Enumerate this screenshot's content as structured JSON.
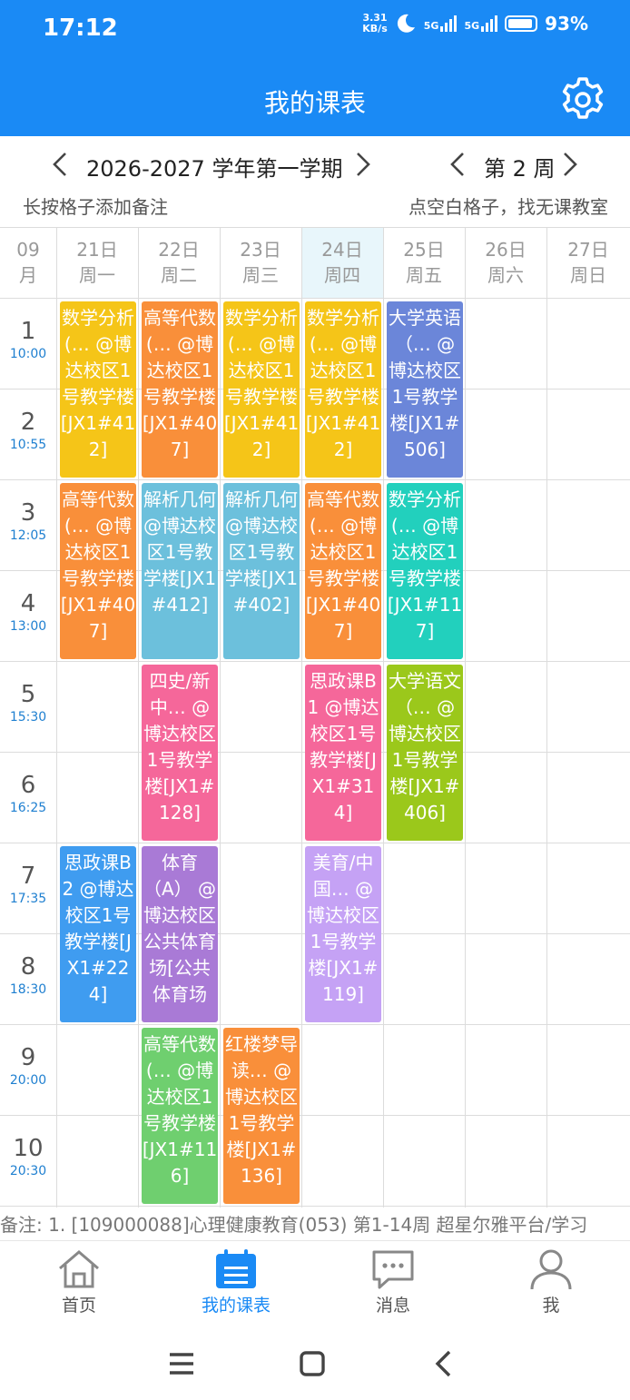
{
  "status_bar": {
    "time": "17:12",
    "speed_value": "3.31",
    "speed_unit": "KB/s",
    "net1": "5G",
    "net2": "5G",
    "battery": "93%"
  },
  "header": {
    "title": "我的课表",
    "settings_icon": "gear-icon"
  },
  "semester": {
    "label": "2026-2027 学年第一学期",
    "week": "第 2 周"
  },
  "hints": {
    "left": "长按格子添加备注",
    "right": "点空白格子，找无课教室"
  },
  "month": {
    "num": "09",
    "unit": "月"
  },
  "days": [
    {
      "date": "21日",
      "weekday": "周一"
    },
    {
      "date": "22日",
      "weekday": "周二"
    },
    {
      "date": "23日",
      "weekday": "周三"
    },
    {
      "date": "24日",
      "weekday": "周四"
    },
    {
      "date": "25日",
      "weekday": "周五"
    },
    {
      "date": "26日",
      "weekday": "周六"
    },
    {
      "date": "27日",
      "weekday": "周日"
    }
  ],
  "periods": [
    {
      "num": "1",
      "time": "10:00"
    },
    {
      "num": "2",
      "time": "10:55"
    },
    {
      "num": "3",
      "time": "12:05"
    },
    {
      "num": "4",
      "time": "13:00"
    },
    {
      "num": "5",
      "time": "15:30"
    },
    {
      "num": "6",
      "time": "16:25"
    },
    {
      "num": "7",
      "time": "17:35"
    },
    {
      "num": "8",
      "time": "18:30"
    },
    {
      "num": "9",
      "time": "20:00"
    },
    {
      "num": "10",
      "time": "20:30"
    }
  ],
  "courses": [
    {
      "day": 1,
      "start": 1,
      "span": 2,
      "color": "#f5c518",
      "text": "数学分析(… @博达校区1号教学楼[JX1#412]"
    },
    {
      "day": 2,
      "start": 1,
      "span": 2,
      "color": "#f98f3a",
      "text": "高等代数(… @博达校区1号教学楼[JX1#407]"
    },
    {
      "day": 3,
      "start": 1,
      "span": 2,
      "color": "#f5c518",
      "text": "数学分析(… @博达校区1号教学楼[JX1#412]"
    },
    {
      "day": 4,
      "start": 1,
      "span": 2,
      "color": "#f5c518",
      "text": "数学分析(… @博达校区1号教学楼[JX1#412]"
    },
    {
      "day": 5,
      "start": 1,
      "span": 2,
      "color": "#6b86d9",
      "text": "大学英语（… @博达校区1号教学楼[JX1#506]"
    },
    {
      "day": 1,
      "start": 3,
      "span": 2,
      "color": "#f98f3a",
      "text": "高等代数(… @博达校区1号教学楼[JX1#407]"
    },
    {
      "day": 2,
      "start": 3,
      "span": 2,
      "color": "#6cc0dc",
      "text": "解析几何 @博达校区1号教学楼[JX1#412]"
    },
    {
      "day": 3,
      "start": 3,
      "span": 2,
      "color": "#6cc0dc",
      "text": "解析几何 @博达校区1号教学楼[JX1#402]"
    },
    {
      "day": 4,
      "start": 3,
      "span": 2,
      "color": "#f98f3a",
      "text": "高等代数(… @博达校区1号教学楼[JX1#407]"
    },
    {
      "day": 5,
      "start": 3,
      "span": 2,
      "color": "#22d0bd",
      "text": "数学分析(… @博达校区1号教学楼[JX1#117]"
    },
    {
      "day": 2,
      "start": 5,
      "span": 2,
      "color": "#f5679a",
      "text": "四史/新中… @博达校区1号教学楼[JX1#128]"
    },
    {
      "day": 4,
      "start": 5,
      "span": 2,
      "color": "#f5679a",
      "text": "思政课B1 @博达校区1号教学楼[JX1#314]"
    },
    {
      "day": 5,
      "start": 5,
      "span": 2,
      "color": "#9bc81b",
      "text": "大学语文（… @博达校区1号教学楼[JX1#406]"
    },
    {
      "day": 1,
      "start": 7,
      "span": 2,
      "color": "#3f9cf0",
      "text": "思政课B2 @博达校区1号教学楼[JX1#224]"
    },
    {
      "day": 2,
      "start": 7,
      "span": 2,
      "color": "#a97ad6",
      "text": "体育（A） @博达校区公共体育场[公共体育场"
    },
    {
      "day": 4,
      "start": 7,
      "span": 2,
      "color": "#c5a2f5",
      "text": "美育/中国… @博达校区1号教学楼[JX1#119]"
    },
    {
      "day": 2,
      "start": 9,
      "span": 2,
      "color": "#6fcf6f",
      "text": "高等代数(… @博达校区1号教学楼[JX1#116]"
    },
    {
      "day": 3,
      "start": 9,
      "span": 2,
      "color": "#f98f3a",
      "text": "红楼梦导读… @博达校区1号教学楼[JX1#136]"
    }
  ],
  "remark": "备注:   1. [109000088]心理健康教育(053) 第1-14周 超星尔雅平台/学习",
  "tabs": [
    {
      "label": "首页",
      "icon": "home-icon",
      "active": false
    },
    {
      "label": "我的课表",
      "icon": "calendar-icon",
      "active": true
    },
    {
      "label": "消息",
      "icon": "message-icon",
      "active": false
    },
    {
      "label": "我",
      "icon": "person-icon",
      "active": false
    }
  ],
  "colors": {
    "primary": "#1a8af5",
    "today_bg": "#e8f6fb",
    "tab_inactive": "#555555"
  },
  "nav_buttons": [
    "menu-icon",
    "home-square-icon",
    "back-icon"
  ]
}
